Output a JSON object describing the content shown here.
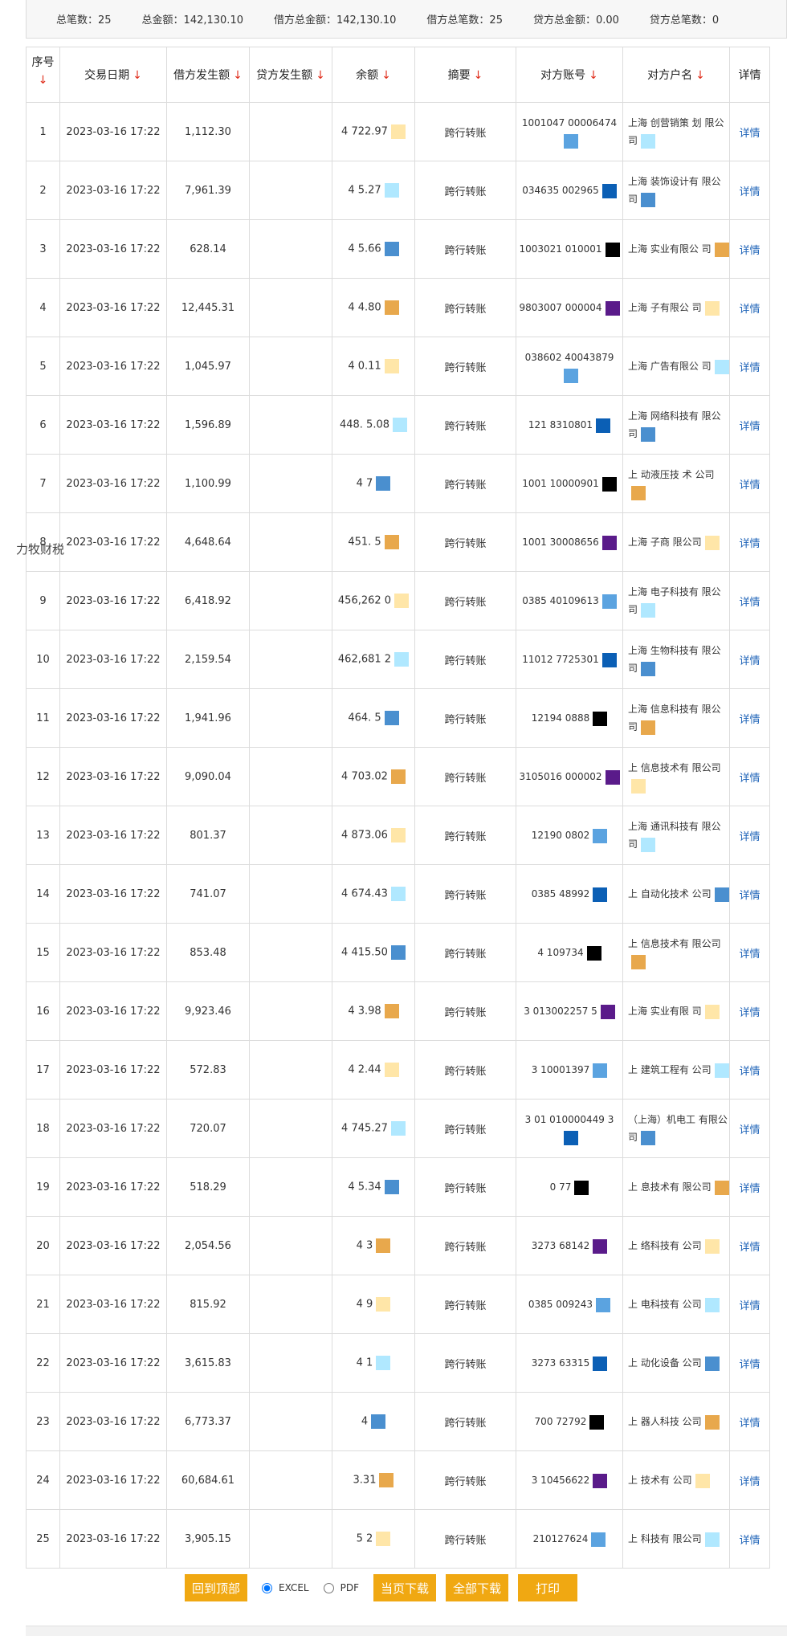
{
  "summary": {
    "total_count": "总笔数：25",
    "total_amount": "总金额：142,130.10",
    "debit_total": "借方总金额：142,130.10",
    "debit_count": "借方总笔数：25",
    "credit_total": "贷方总金额：0.00",
    "credit_count": "贷方总笔数：0"
  },
  "headers": {
    "idx": "序号",
    "date": "交易日期",
    "debit": "借方发生额",
    "credit": "贷方发生额",
    "balance": "余额",
    "memo": "摘要",
    "account": "对方账号",
    "name": "对方户名",
    "detail": "详情",
    "sort_arrow": "↓"
  },
  "rows": [
    {
      "idx": "1",
      "date": "2023-03-16 17:22",
      "debit": "1,112.30",
      "balance": "4 722.97",
      "memo": "跨行转账",
      "account": "1001047 00006474",
      "name": "上海 创营销策 划 限公司"
    },
    {
      "idx": "2",
      "date": "2023-03-16 17:22",
      "debit": "7,961.39",
      "balance": "4 5.27",
      "memo": "跨行转账",
      "account": "034635 002965",
      "name": "上海 装饰设计有 限公司"
    },
    {
      "idx": "3",
      "date": "2023-03-16 17:22",
      "debit": "628.14",
      "balance": "4 5.66",
      "memo": "跨行转账",
      "account": "1003021 010001",
      "name": "上海 实业有限公 司"
    },
    {
      "idx": "4",
      "date": "2023-03-16 17:22",
      "debit": "12,445.31",
      "balance": "4 4.80",
      "memo": "跨行转账",
      "account": "9803007 000004",
      "name": "上海 子有限公 司"
    },
    {
      "idx": "5",
      "date": "2023-03-16 17:22",
      "debit": "1,045.97",
      "balance": "4 0.11",
      "memo": "跨行转账",
      "account": "038602 40043879",
      "name": "上海 广告有限公 司"
    },
    {
      "idx": "6",
      "date": "2023-03-16 17:22",
      "debit": "1,596.89",
      "balance": "448. 5.08",
      "memo": "跨行转账",
      "account": "121 8310801",
      "name": "上海 网络科技有 限公司"
    },
    {
      "idx": "7",
      "date": "2023-03-16 17:22",
      "debit": "1,100.99",
      "balance": "4 7",
      "memo": "跨行转账",
      "account": "1001 10000901",
      "name": "上 动液压技 术 公司"
    },
    {
      "idx": "8",
      "date": "2023-03-16 17:22",
      "debit": "4,648.64",
      "balance": "451. 5",
      "memo": "跨行转账",
      "account": "1001 30008656",
      "name": "上海 子商 限公司"
    },
    {
      "idx": "9",
      "date": "2023-03-16 17:22",
      "debit": "6,418.92",
      "balance": "456,262 0",
      "memo": "跨行转账",
      "account": "0385 40109613",
      "name": "上海 电子科技有 限公司"
    },
    {
      "idx": "10",
      "date": "2023-03-16 17:22",
      "debit": "2,159.54",
      "balance": "462,681 2",
      "memo": "跨行转账",
      "account": "11012 7725301",
      "name": "上海 生物科技有 限公司"
    },
    {
      "idx": "11",
      "date": "2023-03-16 17:22",
      "debit": "1,941.96",
      "balance": "464. 5",
      "memo": "跨行转账",
      "account": "12194 0888",
      "name": "上海 信息科技有 限公司"
    },
    {
      "idx": "12",
      "date": "2023-03-16 17:22",
      "debit": "9,090.04",
      "balance": "4 703.02",
      "memo": "跨行转账",
      "account": "3105016 000002",
      "name": "上 信息技术有 限公司"
    },
    {
      "idx": "13",
      "date": "2023-03-16 17:22",
      "debit": "801.37",
      "balance": "4 873.06",
      "memo": "跨行转账",
      "account": "12190 0802",
      "name": "上海 通讯科技有 限公司"
    },
    {
      "idx": "14",
      "date": "2023-03-16 17:22",
      "debit": "741.07",
      "balance": "4 674.43",
      "memo": "跨行转账",
      "account": "0385 48992",
      "name": "上 自动化技术 公司"
    },
    {
      "idx": "15",
      "date": "2023-03-16 17:22",
      "debit": "853.48",
      "balance": "4 415.50",
      "memo": "跨行转账",
      "account": "4 109734",
      "name": "上 信息技术有 限公司"
    },
    {
      "idx": "16",
      "date": "2023-03-16 17:22",
      "debit": "9,923.46",
      "balance": "4 3.98",
      "memo": "跨行转账",
      "account": "3 013002257 5",
      "name": "上海 实业有限 司"
    },
    {
      "idx": "17",
      "date": "2023-03-16 17:22",
      "debit": "572.83",
      "balance": "4 2.44",
      "memo": "跨行转账",
      "account": "3 10001397",
      "name": "上 建筑工程有 公司"
    },
    {
      "idx": "18",
      "date": "2023-03-16 17:22",
      "debit": "720.07",
      "balance": "4 745.27",
      "memo": "跨行转账",
      "account": "3 01 010000449 3",
      "name": "（上海）机电工 有限公司"
    },
    {
      "idx": "19",
      "date": "2023-03-16 17:22",
      "debit": "518.29",
      "balance": "4 5.34",
      "memo": "跨行转账",
      "account": "0 77",
      "name": "上 息技术有 限公司"
    },
    {
      "idx": "20",
      "date": "2023-03-16 17:22",
      "debit": "2,054.56",
      "balance": "4 3",
      "memo": "跨行转账",
      "account": "3273 68142",
      "name": "上 络科技有 公司"
    },
    {
      "idx": "21",
      "date": "2023-03-16 17:22",
      "debit": "815.92",
      "balance": "4 9",
      "memo": "跨行转账",
      "account": "0385 009243",
      "name": "上 电科技有 公司"
    },
    {
      "idx": "22",
      "date": "2023-03-16 17:22",
      "debit": "3,615.83",
      "balance": "4 1",
      "memo": "跨行转账",
      "account": "3273 63315",
      "name": "上 动化设备 公司"
    },
    {
      "idx": "23",
      "date": "2023-03-16 17:22",
      "debit": "6,773.37",
      "balance": "4",
      "memo": "跨行转账",
      "account": "700 72792",
      "name": "上 器人科技 公司"
    },
    {
      "idx": "24",
      "date": "2023-03-16 17:22",
      "debit": "60,684.61",
      "balance": "3.31",
      "memo": "跨行转账",
      "account": "3 10456622",
      "name": "上 技术有 公司"
    },
    {
      "idx": "25",
      "date": "2023-03-16 17:22",
      "debit": "3,905.15",
      "balance": "5 2",
      "memo": "跨行转账",
      "account": "210127624",
      "name": "上 科技有 限公司"
    }
  ],
  "detail_label": "详情",
  "watermark": "力牧财税",
  "footer": {
    "back_top": "回到顶部",
    "excel": "EXCEL",
    "pdf": "PDF",
    "page_download": "当页下载",
    "all_download": "全部下载",
    "print": "打印"
  }
}
